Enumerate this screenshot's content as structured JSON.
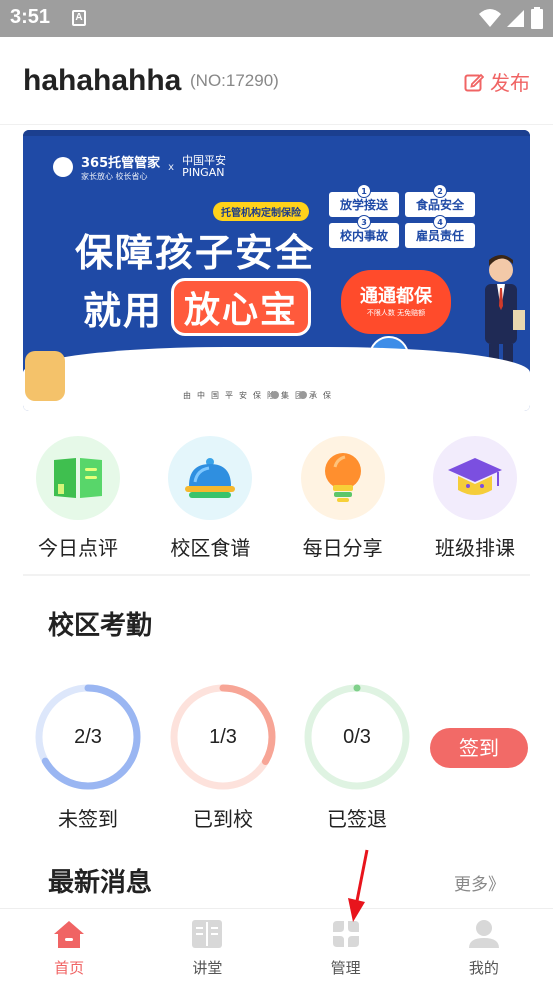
{
  "status_bar": {
    "time": "3:51",
    "a_icon": "A"
  },
  "header": {
    "username": "hahahahha",
    "user_no": "(NO:17290)",
    "publish_label": "发布"
  },
  "banner": {
    "brand_left": "365托管管家",
    "brand_left_sub": "家长放心  校长省心",
    "brand_x": "x",
    "brand_right_1": "中国平安",
    "brand_right_2": "PINGAN",
    "tag": "托管机构定制保险",
    "headline_1": "保障孩子安全",
    "headline_2_prefix": "就用",
    "headline_2_pill": "放心宝",
    "features": [
      {
        "num": "1",
        "label": "放学接送"
      },
      {
        "num": "2",
        "label": "食品安全"
      },
      {
        "num": "3",
        "label": "校内事故"
      },
      {
        "num": "4",
        "label": "雇员责任"
      }
    ],
    "burst_title": "通通都保",
    "burst_sub": "不限人数  无免赔额",
    "badge_text": "一次投保 安心一年",
    "footer_text": "由中国平安保险集团承保"
  },
  "quick_menu": [
    {
      "label": "今日点评",
      "icon": "book-icon",
      "bg": "#e6f9e8"
    },
    {
      "label": "校区食谱",
      "icon": "food-cover-icon",
      "bg": "#e4f6fb"
    },
    {
      "label": "每日分享",
      "icon": "lightbulb-icon",
      "bg": "#fff3e2"
    },
    {
      "label": "班级排课",
      "icon": "graduation-cap-icon",
      "bg": "#f2ecfc"
    }
  ],
  "attendance": {
    "title": "校区考勤",
    "rings": [
      {
        "value": "2/3",
        "label": "未签到",
        "fraction": 0.667,
        "color": "#9ab6f2",
        "track": "#dde7fb"
      },
      {
        "value": "1/3",
        "label": "已到校",
        "fraction": 0.333,
        "color": "#f7a596",
        "track": "#fde2dc"
      },
      {
        "value": "0/3",
        "label": "已签退",
        "fraction": 0.0,
        "color": "#7fd08a",
        "track": "#dff3e2"
      }
    ],
    "signin_label": "签到"
  },
  "news": {
    "title": "最新消息",
    "more_label": "更多》"
  },
  "tabs": [
    {
      "label": "首页",
      "icon": "home-icon",
      "active": true
    },
    {
      "label": "讲堂",
      "icon": "open-book-icon",
      "active": false
    },
    {
      "label": "管理",
      "icon": "grid-petals-icon",
      "active": false
    },
    {
      "label": "我的",
      "icon": "user-icon",
      "active": false
    }
  ],
  "colors": {
    "accent": "#f06464",
    "banner_blue": "#1f4aa6"
  }
}
